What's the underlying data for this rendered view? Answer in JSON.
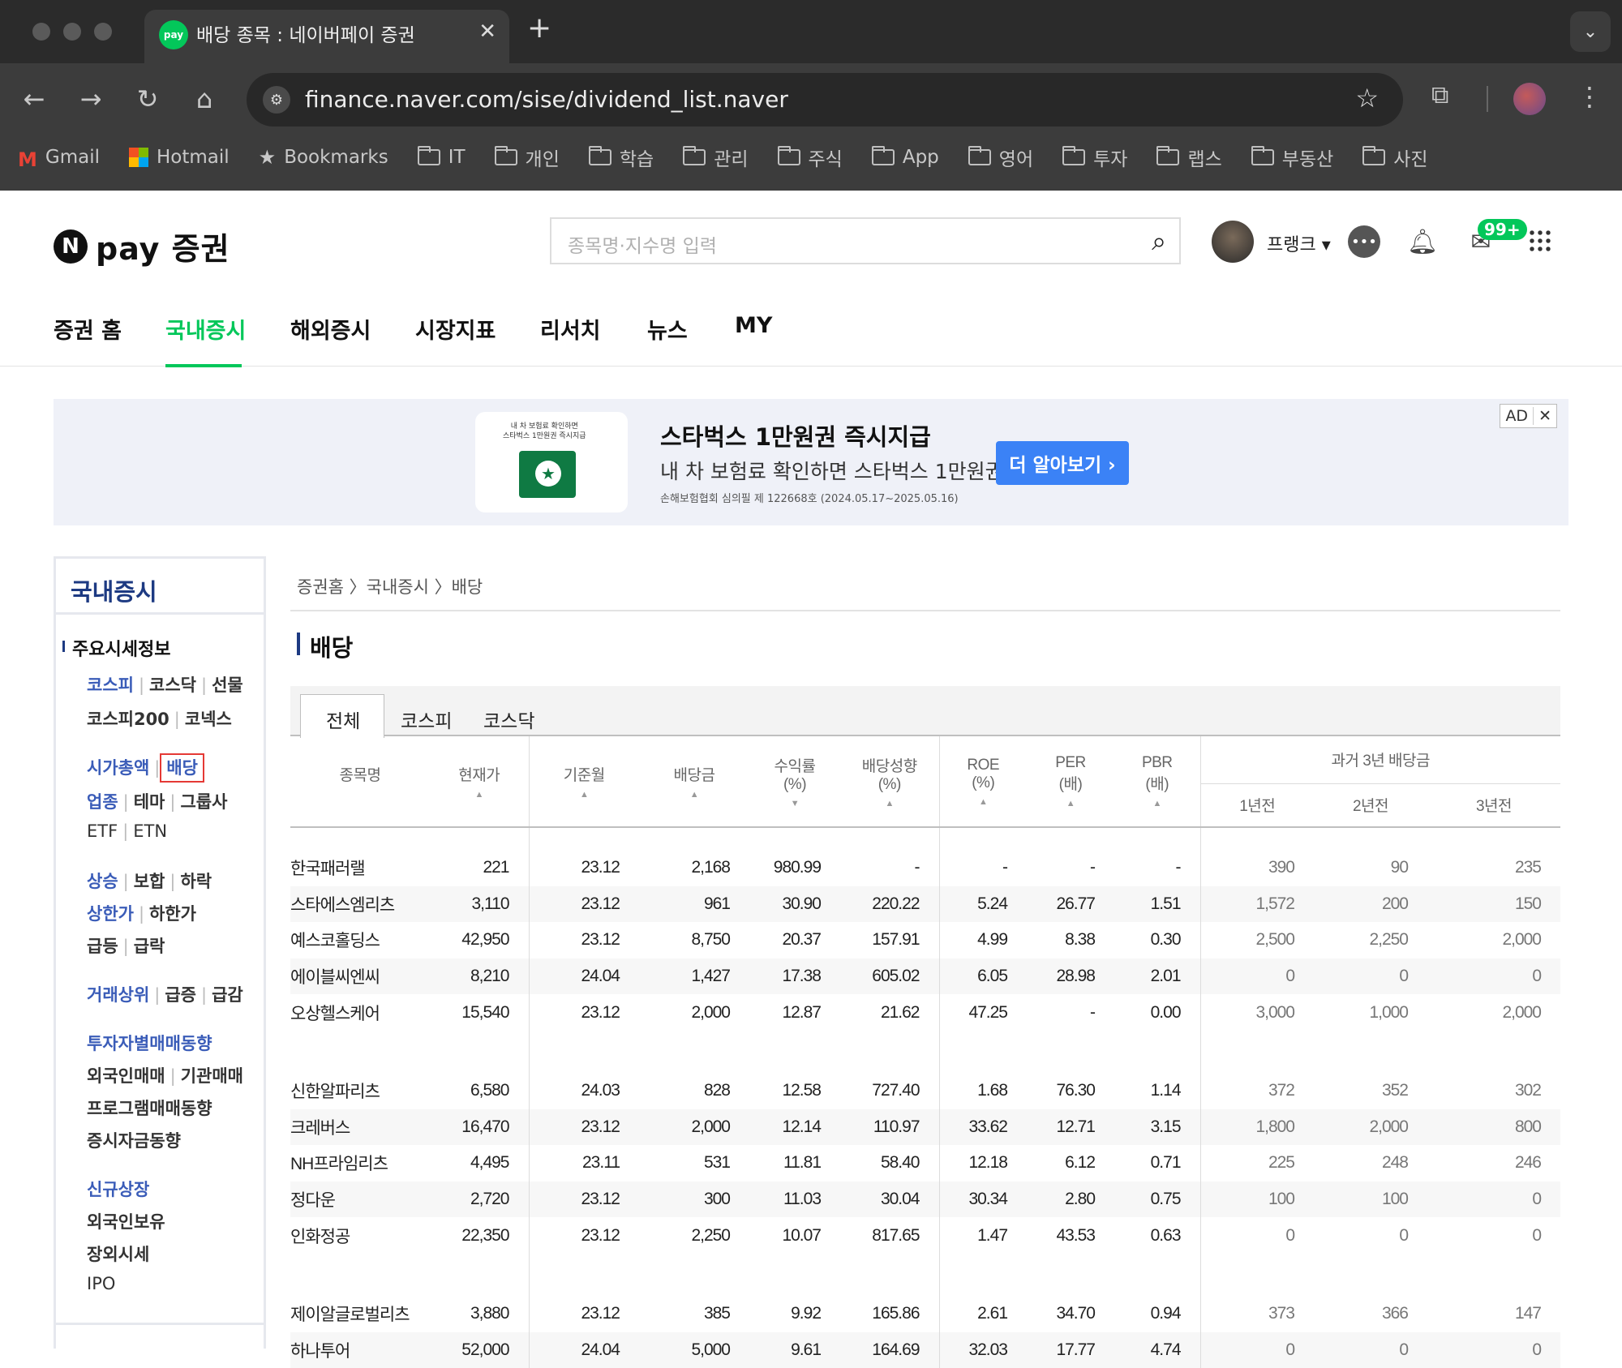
{
  "browser": {
    "tab_title": "배당 종목 : 네이버페이 증권",
    "tab_favicon": "pay",
    "url": "finance.naver.com/sise/dividend_list.naver",
    "bookmarks": [
      "Gmail",
      "Hotmail",
      "Bookmarks",
      "IT",
      "개인",
      "학습",
      "관리",
      "주식",
      "App",
      "영어",
      "투자",
      "랩스",
      "부동산",
      "사진"
    ]
  },
  "header": {
    "logo_text": "pay 증권",
    "logo_letter": "N",
    "search_placeholder": "종목명·지수명 입력",
    "username": "프랭크",
    "mail_badge": "99+"
  },
  "gnb": [
    "증권 홈",
    "국내증시",
    "해외증시",
    "시장지표",
    "리서치",
    "뉴스",
    "MY"
  ],
  "gnb_active": "국내증시",
  "ad": {
    "img_caption": "내 차 보험료 확인하면\n스타벅스 1만원권 즉시지급",
    "title": "스타벅스 1만원권 즉시지급",
    "subtitle": "내 차 보험료 확인하면 스타벅스 1만원권",
    "fineprint": "손해보험협회 심의필 제 122668호 (2024.05.17~2025.05.16)",
    "button": "더 알아보기 ›",
    "badge": "AD",
    "close": "✕"
  },
  "lnb": {
    "title": "국내증시",
    "section": "주요시세정보",
    "rows": [
      [
        "코스피",
        "코스닥",
        "선물"
      ],
      [
        "코스피200",
        "코넥스"
      ],
      [
        "시가총액",
        "배당"
      ],
      [
        "업종",
        "테마",
        "그룹사"
      ],
      [
        "ETF",
        "ETN"
      ],
      [
        "상승",
        "보합",
        "하락"
      ],
      [
        "상한가",
        "하한가"
      ],
      [
        "급등",
        "급락"
      ],
      [
        "거래상위",
        "급증",
        "급감"
      ],
      [
        "투자자별매매동향"
      ],
      [
        "외국인매매",
        "기관매매"
      ],
      [
        "프로그램매매동향"
      ],
      [
        "증시자금동향"
      ],
      [
        "신규상장"
      ],
      [
        "외국인보유"
      ],
      [
        "장외시세"
      ],
      [
        "IPO"
      ]
    ]
  },
  "breadcrumb": "증권홈 〉국내증시 〉배당",
  "page_title": "배당",
  "tabs": [
    "전체",
    "코스피",
    "코스닥"
  ],
  "table": {
    "headers": [
      "종목명",
      "현재가",
      "기준월",
      "배당금",
      "수익률\n(%)",
      "배당성향\n(%)",
      "ROE\n(%)",
      "PER\n(배)",
      "PBR\n(배)"
    ],
    "history_header": "과거 3년 배당금",
    "history_cols": [
      "1년전",
      "2년전",
      "3년전"
    ],
    "groups": [
      [
        [
          "한국패러랠",
          "221",
          "23.12",
          "2,168",
          "980.99",
          "-",
          "-",
          "-",
          "-",
          "390",
          "90",
          "235"
        ],
        [
          "스타에스엠리츠",
          "3,110",
          "23.12",
          "961",
          "30.90",
          "220.22",
          "5.24",
          "26.77",
          "1.51",
          "1,572",
          "200",
          "150"
        ],
        [
          "예스코홀딩스",
          "42,950",
          "23.12",
          "8,750",
          "20.37",
          "157.91",
          "4.99",
          "8.38",
          "0.30",
          "2,500",
          "2,250",
          "2,000"
        ],
        [
          "에이블씨엔씨",
          "8,210",
          "24.04",
          "1,427",
          "17.38",
          "605.02",
          "6.05",
          "28.98",
          "2.01",
          "0",
          "0",
          "0"
        ],
        [
          "오상헬스케어",
          "15,540",
          "23.12",
          "2,000",
          "12.87",
          "21.62",
          "47.25",
          "-",
          "0.00",
          "3,000",
          "1,000",
          "2,000"
        ]
      ],
      [
        [
          "신한알파리츠",
          "6,580",
          "24.03",
          "828",
          "12.58",
          "727.40",
          "1.68",
          "76.30",
          "1.14",
          "372",
          "352",
          "302"
        ],
        [
          "크레버스",
          "16,470",
          "23.12",
          "2,000",
          "12.14",
          "110.97",
          "33.62",
          "12.71",
          "3.15",
          "1,800",
          "2,000",
          "800"
        ],
        [
          "NH프라임리츠",
          "4,495",
          "23.11",
          "531",
          "11.81",
          "58.40",
          "12.18",
          "6.12",
          "0.71",
          "225",
          "248",
          "246"
        ],
        [
          "정다운",
          "2,720",
          "23.12",
          "300",
          "11.03",
          "30.04",
          "30.34",
          "2.80",
          "0.75",
          "100",
          "100",
          "0"
        ],
        [
          "인화정공",
          "22,350",
          "23.12",
          "2,250",
          "10.07",
          "817.65",
          "1.47",
          "43.53",
          "0.63",
          "0",
          "0",
          "0"
        ]
      ],
      [
        [
          "제이알글로벌리츠",
          "3,880",
          "23.12",
          "385",
          "9.92",
          "165.86",
          "2.61",
          "34.70",
          "0.94",
          "373",
          "366",
          "147"
        ],
        [
          "하나투어",
          "52,000",
          "24.04",
          "5,000",
          "9.61",
          "164.69",
          "32.03",
          "17.77",
          "4.74",
          "0",
          "0",
          "0"
        ]
      ]
    ]
  }
}
